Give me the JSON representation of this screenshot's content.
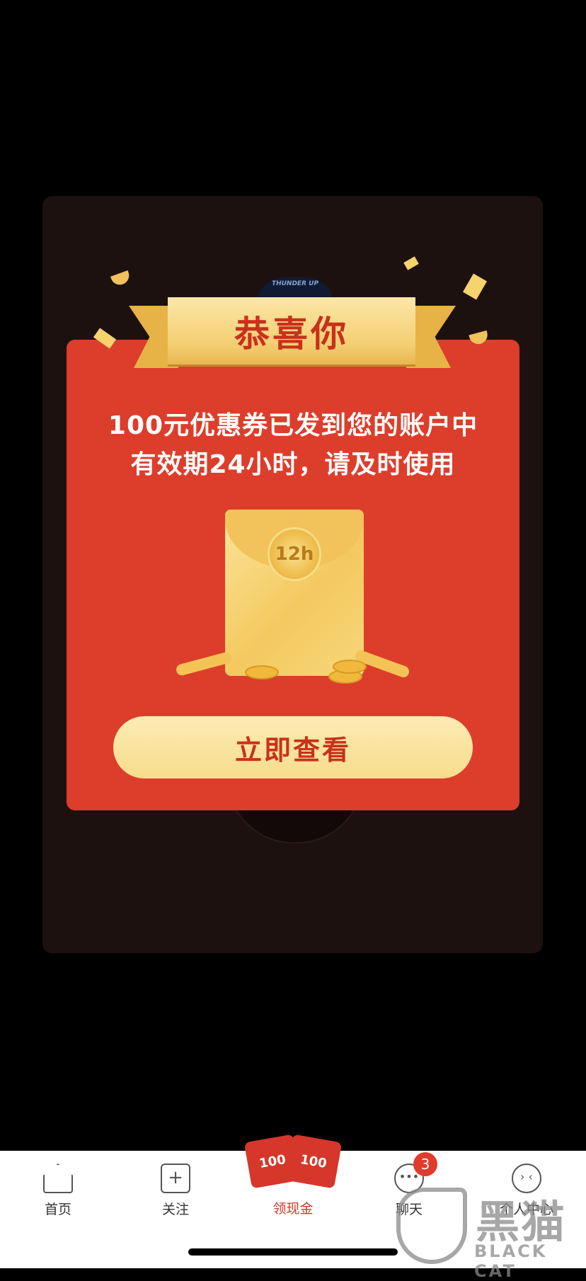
{
  "background": {
    "brand_text": "THUNDER UP"
  },
  "popup": {
    "title": "恭喜你",
    "line1": "100元优惠券已发到您的账户中",
    "line2": "有效期24小时，请及时使用",
    "envelope_badge": "12h",
    "cta_label": "立即查看"
  },
  "tabbar": {
    "tabs": [
      {
        "label": "首页",
        "icon": "home-icon"
      },
      {
        "label": "关注",
        "icon": "plus-icon"
      },
      {
        "label": "领现金",
        "icon": "red-envelope-icon",
        "badge_text_1": "100",
        "badge_text_2": "100"
      },
      {
        "label": "聊天",
        "icon": "chat-icon",
        "badge_count": "3"
      },
      {
        "label": "个人中心",
        "icon": "profile-icon"
      }
    ]
  },
  "watermark": {
    "cn": "黑猫",
    "en": "BLACK CAT"
  },
  "colors": {
    "accent_red": "#dc3e2b",
    "gold": "#f4cf72",
    "title_red": "#c8311c"
  }
}
